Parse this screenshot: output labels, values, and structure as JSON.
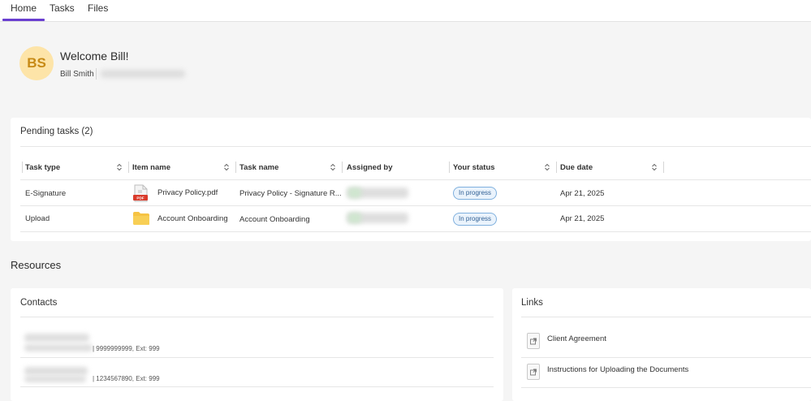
{
  "tabs": [
    {
      "label": "Home",
      "active": true
    },
    {
      "label": "Tasks",
      "active": false
    },
    {
      "label": "Files",
      "active": false
    }
  ],
  "profile": {
    "initials": "BS",
    "welcome": "Welcome Bill!",
    "name": "Bill Smith"
  },
  "pending": {
    "title": "Pending tasks (2)",
    "columns": [
      "Task type",
      "Item name",
      "Task name",
      "Assigned by",
      "Your status",
      "Due date"
    ],
    "rows": [
      {
        "task_type": "E-Signature",
        "item_name": "Privacy Policy.pdf",
        "item_icon": "pdf-icon",
        "task_name": "Privacy Policy - Signature R...",
        "status": "In progress",
        "due": "Apr 21, 2025"
      },
      {
        "task_type": "Upload",
        "item_name": "Account Onboarding",
        "item_icon": "folder-icon",
        "task_name": "Account Onboarding",
        "status": "In progress",
        "due": "Apr 21, 2025"
      }
    ]
  },
  "resources": {
    "title": "Resources",
    "contacts": {
      "title": "Contacts",
      "items": [
        {
          "phone": "| 9999999999, Ext: 999"
        },
        {
          "phone": "| 1234567890, Ext: 999"
        }
      ]
    },
    "links": {
      "title": "Links",
      "items": [
        {
          "label": "Client Agreement"
        },
        {
          "label": "Instructions for Uploading the Documents"
        }
      ]
    }
  },
  "colors": {
    "accent": "#6a3fd0",
    "avatar_bg": "#fde4a8",
    "avatar_fg": "#c78a16",
    "badge_border": "#7fb0de",
    "folder": "#f6c343",
    "pdf_red": "#d93a2b"
  }
}
